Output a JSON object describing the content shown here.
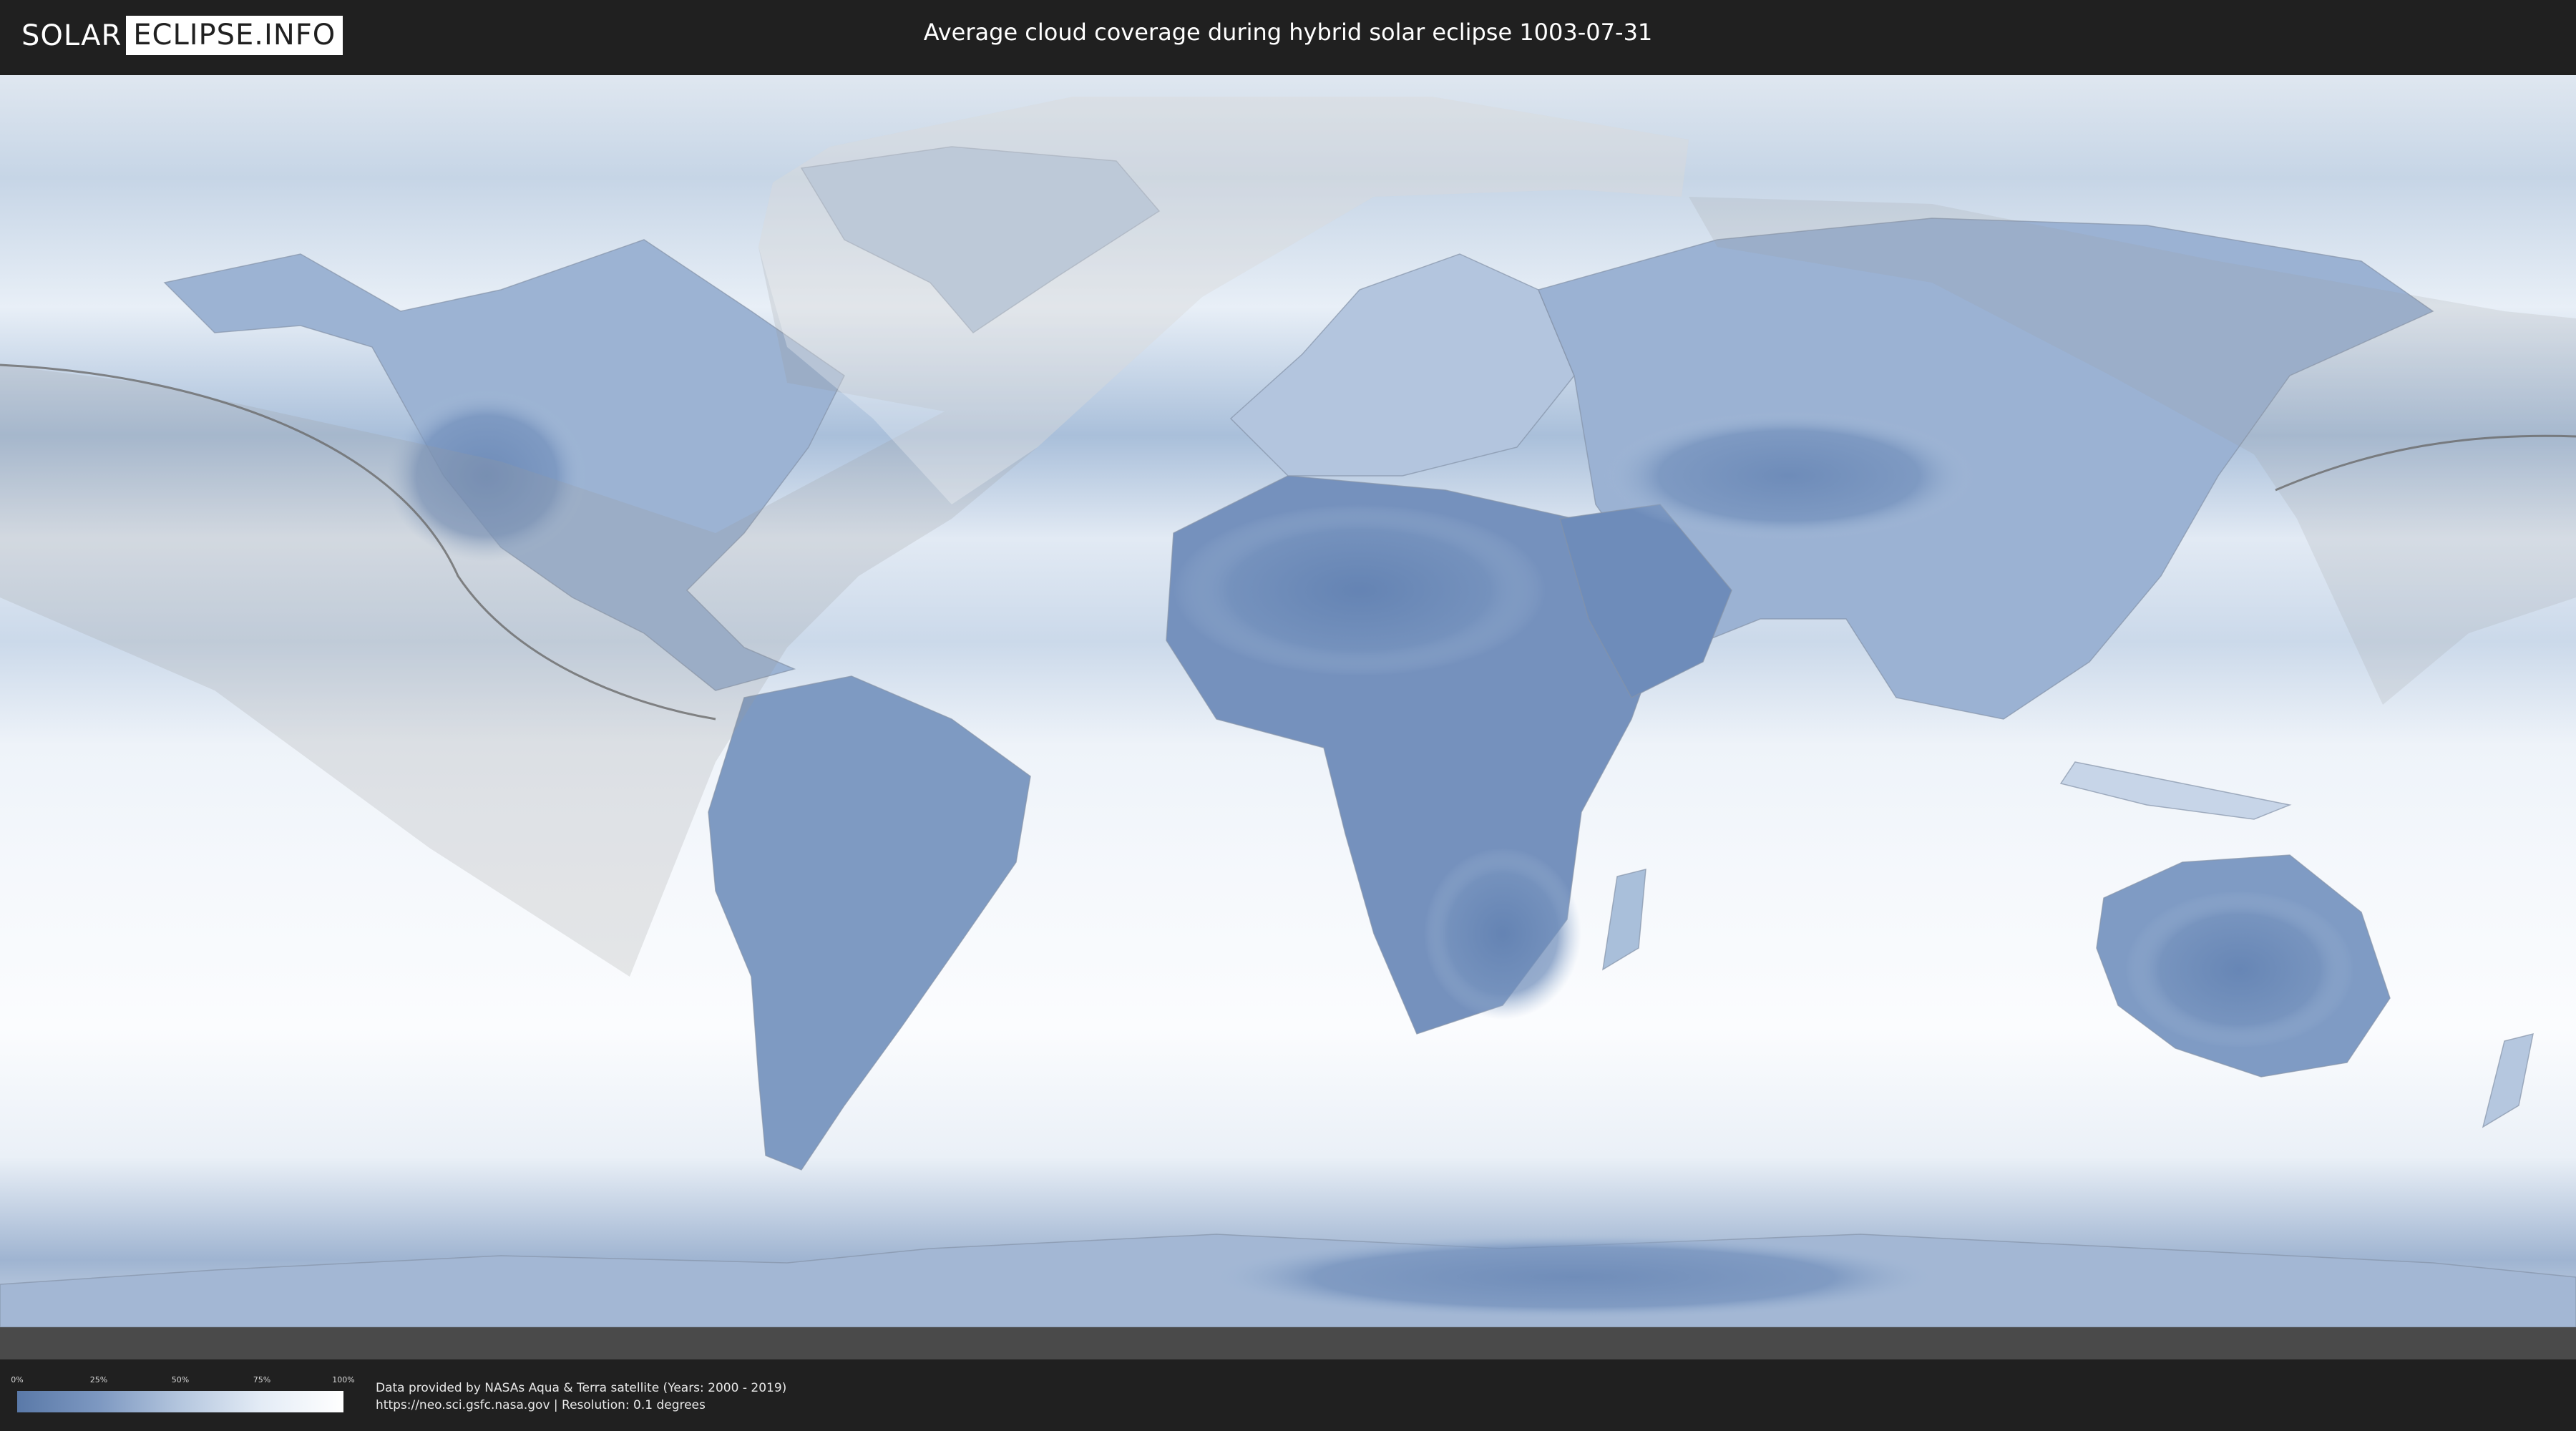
{
  "header": {
    "logo_left": "SOLAR",
    "logo_right": "ECLIPSE.INFO",
    "title": "Average cloud coverage during hybrid solar eclipse 1003-07-31"
  },
  "legend": {
    "ticks": [
      "0%",
      "25%",
      "50%",
      "75%",
      "100%"
    ],
    "min_color": "#5a79a8",
    "max_color": "#ffffff"
  },
  "footer": {
    "credit_line_1": "Data provided by NASAs Aqua & Terra satellite (Years: 2000 - 2019)",
    "credit_line_2": "https://neo.sci.gsfc.nasa.gov | Resolution: 0.1 degrees"
  },
  "colors": {
    "background": "#202020",
    "cloud_clear": "#5a79a8",
    "cloud_full": "#ffffff",
    "eclipse_path": "#6a6a6a"
  }
}
